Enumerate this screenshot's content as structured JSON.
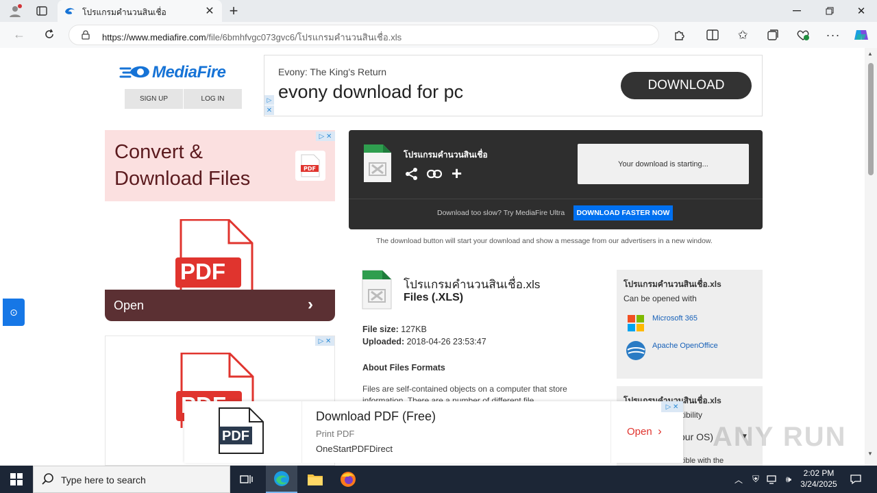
{
  "browser": {
    "tab_title": "โปรแกรมคำนวนสินเชื่อ",
    "url_host": "https://www.mediafire.com",
    "url_path": "/file/6bmhfvgc073gvc6/โปรแกรมคำนวนสินเชื่อ.xls",
    "icons": [
      "profile-icon",
      "tab-actions-icon",
      "edge-tab-favicon",
      "close-tab-icon",
      "new-tab-icon",
      "minimize-icon",
      "restore-icon",
      "window-close-icon",
      "back-icon",
      "refresh-icon",
      "lock-icon",
      "read-aloud-icon",
      "favorite-star-icon",
      "extensions-icon",
      "split-screen-icon",
      "favorites-icon",
      "collections-icon",
      "browser-essentials-icon",
      "more-icon",
      "copilot-icon"
    ]
  },
  "site": {
    "logo_text": "MediaFire",
    "signup": "SIGN UP",
    "login": "LOG IN"
  },
  "top_ad": {
    "small": "Evony: The King's Return",
    "big": "evony download for pc",
    "button": "DOWNLOAD"
  },
  "side_ad1": {
    "line1": "Convert &",
    "line2": "Download Files",
    "pdf_label": "PDF",
    "open": "Open"
  },
  "side_ad2": {
    "pdf_label": "PDF"
  },
  "download_box": {
    "file_name": "โปรแกรมคำนวนสินเชื่อ",
    "status": "Your download is starting...",
    "slow_text": "Download too slow? Try MediaFire Ultra",
    "faster_button": "DOWNLOAD FASTER NOW",
    "notice": "The download button will start your download and show a message from our advertisers in a new window."
  },
  "file_info": {
    "name": "โปรแกรมคำนวนสินเชื่อ.xls",
    "type": "Files (.XLS)",
    "size_label": "File size:",
    "size": "127KB",
    "uploaded_label": "Uploaded:",
    "uploaded": "2018-04-26 23:53:47",
    "about_heading": "About Files Formats",
    "about_text": "Files are self-contained objects on a computer that store information. There are a number of different file"
  },
  "open_with": {
    "title": "โปรแกรมคำนวนสินเชื่อ.xls",
    "subtitle": "Can be opened with",
    "apps": [
      "Microsoft 365",
      "Apache OpenOffice"
    ]
  },
  "compat_box": {
    "title": "โปรแกรมคำนวนสินเชื่อ.xls",
    "line1": "tibility",
    "select": "our OS)",
    "line2": "tible with the"
  },
  "bottom_ad": {
    "title": "Download PDF (Free)",
    "sub": "Print PDF",
    "brand": "OneStartPDFDirect",
    "pdf_label": "PDF",
    "open": "Open"
  },
  "watermark": "ANY RUN",
  "taskbar": {
    "search_placeholder": "Type here to search",
    "time": "2:02 PM",
    "date": "3/24/2025"
  },
  "colors": {
    "mediafire_blue": "#1673d6",
    "faster_blue": "#0070f0",
    "dark_box": "#2e2e2e",
    "ad_pink": "#fbe0e0",
    "ad_maroon": "#5b3033",
    "pdf_red": "#e0342e"
  }
}
